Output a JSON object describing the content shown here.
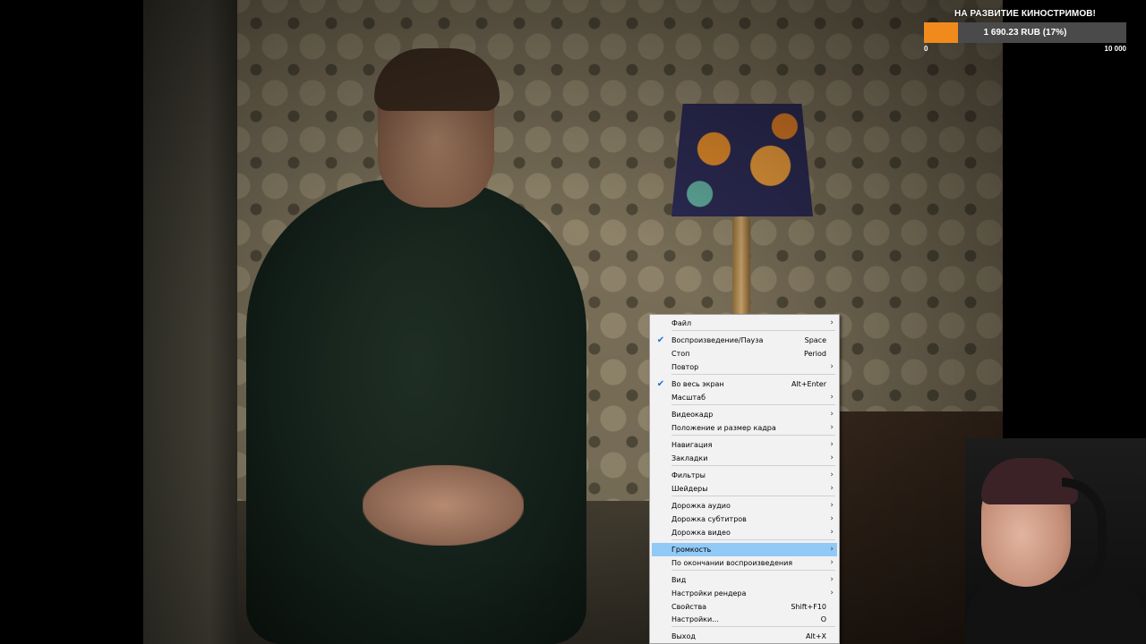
{
  "donation": {
    "title": "НА РАЗВИТИЕ КИНОСТРИМОВ!",
    "amount_text": "1 690.23 RUB (17%)",
    "progress_fraction": 0.17,
    "min_label": "0",
    "max_label": "10 000",
    "fill_color": "#f08a1c"
  },
  "context_menu": {
    "items": [
      {
        "label": "Файл",
        "shortcut": "",
        "submenu": true,
        "checked": false
      },
      {
        "label": "Воспроизведение/Пауза",
        "shortcut": "Space",
        "submenu": false,
        "checked": true
      },
      {
        "label": "Стоп",
        "shortcut": "Period",
        "submenu": false,
        "checked": false
      },
      {
        "label": "Повтор",
        "shortcut": "",
        "submenu": true,
        "checked": false
      },
      {
        "label": "Во весь экран",
        "shortcut": "Alt+Enter",
        "submenu": false,
        "checked": true
      },
      {
        "label": "Масштаб",
        "shortcut": "",
        "submenu": true,
        "checked": false
      },
      {
        "label": "Видеокадр",
        "shortcut": "",
        "submenu": true,
        "checked": false
      },
      {
        "label": "Положение и размер кадра",
        "shortcut": "",
        "submenu": true,
        "checked": false
      },
      {
        "label": "Навигация",
        "shortcut": "",
        "submenu": true,
        "checked": false
      },
      {
        "label": "Закладки",
        "shortcut": "",
        "submenu": true,
        "checked": false
      },
      {
        "label": "Фильтры",
        "shortcut": "",
        "submenu": true,
        "checked": false
      },
      {
        "label": "Шейдеры",
        "shortcut": "",
        "submenu": true,
        "checked": false
      },
      {
        "label": "Дорожка аудио",
        "shortcut": "",
        "submenu": true,
        "checked": false
      },
      {
        "label": "Дорожка субтитров",
        "shortcut": "",
        "submenu": true,
        "checked": false
      },
      {
        "label": "Дорожка видео",
        "shortcut": "",
        "submenu": true,
        "checked": false
      },
      {
        "label": "Громкость",
        "shortcut": "",
        "submenu": true,
        "checked": false,
        "highlighted": true
      },
      {
        "label": "По окончании воспроизведения",
        "shortcut": "",
        "submenu": true,
        "checked": false
      },
      {
        "label": "Вид",
        "shortcut": "",
        "submenu": true,
        "checked": false
      },
      {
        "label": "Настройки рендера",
        "shortcut": "",
        "submenu": true,
        "checked": false
      },
      {
        "label": "Свойства",
        "shortcut": "Shift+F10",
        "submenu": false,
        "checked": false
      },
      {
        "label": "Настройки...",
        "shortcut": "O",
        "submenu": false,
        "checked": false
      },
      {
        "label": "Выход",
        "shortcut": "Alt+X",
        "submenu": false,
        "checked": false
      }
    ],
    "check_glyph": "✔",
    "arrow_glyph": "›",
    "highlight_color": "#91c9f7"
  },
  "icons": {
    "check": "checkmark-icon",
    "submenu": "chevron-right-icon"
  }
}
